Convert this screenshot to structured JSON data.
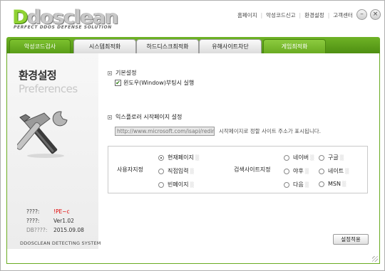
{
  "app": {
    "logo_text_rest": "dosclean",
    "logo_text_d": "D",
    "logo_sub": "PERFECT DDOS DEFENSE SOLUTION"
  },
  "top_menu": [
    "홈페이지",
    "악성코드신고",
    "환경설정",
    "고객센터"
  ],
  "window_controls": {
    "minimize_icon": "–",
    "close_icon": "×"
  },
  "tabs": [
    {
      "label": "악성코드검사",
      "state": "active"
    },
    {
      "label": "시스템최적화",
      "state": "normal"
    },
    {
      "label": "하드디스크최적화",
      "state": "normal"
    },
    {
      "label": "유해사이트차단",
      "state": "normal"
    },
    {
      "label": "게임최적화",
      "state": "highlight"
    }
  ],
  "left_panel": {
    "title": "환경설정",
    "subtitle": "Preferences",
    "info": [
      {
        "key": "????:",
        "value": "!PE~c"
      },
      {
        "key": "????:",
        "value": "Ver1.02"
      },
      {
        "key": "DB????:",
        "value": "2015.09.08"
      }
    ],
    "brand_line": "DDOSCLEAN   DETECTING SYSTEM"
  },
  "basic": {
    "title": "기본설정",
    "boot_label": "윈도우(Window)부팅시 실행",
    "boot_checked": true
  },
  "ie": {
    "title": "익스플로러 시작페이지 설정",
    "url_value": "http://www.microsoft.com/isapi/redir",
    "hint": "시작페이지로 정할 사이트 주소가 표시됩니다."
  },
  "user_spec": {
    "label": "사용자지정",
    "options": [
      {
        "label": "현재페이지",
        "selected": true
      },
      {
        "label": "직접입력",
        "selected": false
      },
      {
        "label": "빈페이지",
        "selected": false
      }
    ]
  },
  "search_spec": {
    "label": "검색사이트지정",
    "options": [
      {
        "label": "네이버",
        "selected": false
      },
      {
        "label": "구글",
        "selected": false
      },
      {
        "label": "야후",
        "selected": false
      },
      {
        "label": "네이트",
        "selected": false
      },
      {
        "label": "다음",
        "selected": false
      },
      {
        "label": "MSN",
        "selected": false
      }
    ]
  },
  "apply_label": "설정적용",
  "colors": {
    "accent_green": "#6fb326",
    "error_red": "#e00000"
  }
}
